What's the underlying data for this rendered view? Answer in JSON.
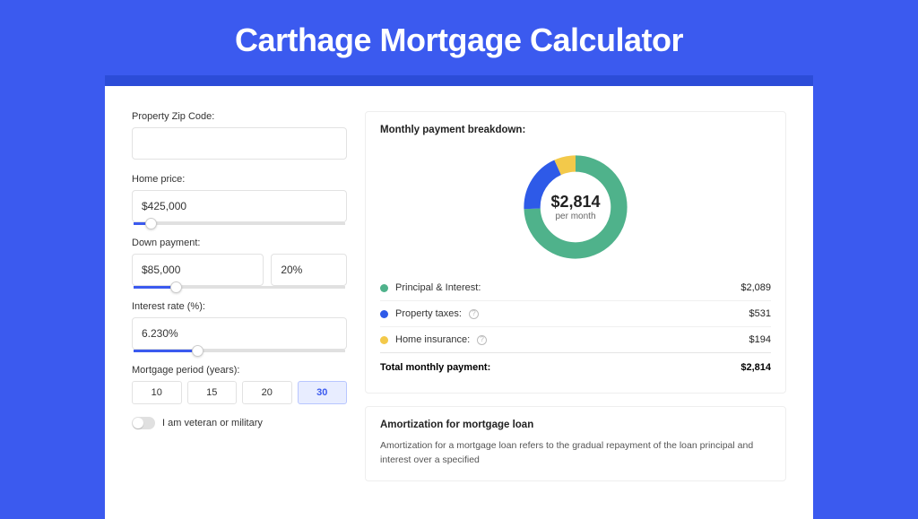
{
  "header": {
    "title": "Carthage Mortgage Calculator"
  },
  "form": {
    "zip": {
      "label": "Property Zip Code:",
      "value": ""
    },
    "price": {
      "label": "Home price:",
      "value": "$425,000",
      "slider_pct": 8
    },
    "down": {
      "label": "Down payment:",
      "amount": "$85,000",
      "pct": "20%",
      "slider_pct": 20
    },
    "rate": {
      "label": "Interest rate (%):",
      "value": "6.230%",
      "slider_pct": 30
    },
    "period": {
      "label": "Mortgage period (years):",
      "options": [
        "10",
        "15",
        "20",
        "30"
      ],
      "selected": "30"
    },
    "veteran": {
      "label": "I am veteran or military",
      "checked": false
    }
  },
  "breakdown": {
    "title": "Monthly payment breakdown:",
    "center_value": "$2,814",
    "center_sub": "per month",
    "rows": [
      {
        "label": "Principal & Interest:",
        "value": "$2,089",
        "color": "#4fb28b",
        "info": false
      },
      {
        "label": "Property taxes:",
        "value": "$531",
        "color": "#2e5ae8",
        "info": true
      },
      {
        "label": "Home insurance:",
        "value": "$194",
        "color": "#f3c94a",
        "info": true
      }
    ],
    "total": {
      "label": "Total monthly payment:",
      "value": "$2,814"
    }
  },
  "amortization": {
    "title": "Amortization for mortgage loan",
    "text": "Amortization for a mortgage loan refers to the gradual repayment of the loan principal and interest over a specified"
  },
  "chart_data": {
    "type": "pie",
    "title": "Monthly payment breakdown",
    "series": [
      {
        "name": "Principal & Interest",
        "value": 2089,
        "color": "#4fb28b"
      },
      {
        "name": "Property taxes",
        "value": 531,
        "color": "#2e5ae8"
      },
      {
        "name": "Home insurance",
        "value": 194,
        "color": "#f3c94a"
      }
    ],
    "total": 2814
  }
}
